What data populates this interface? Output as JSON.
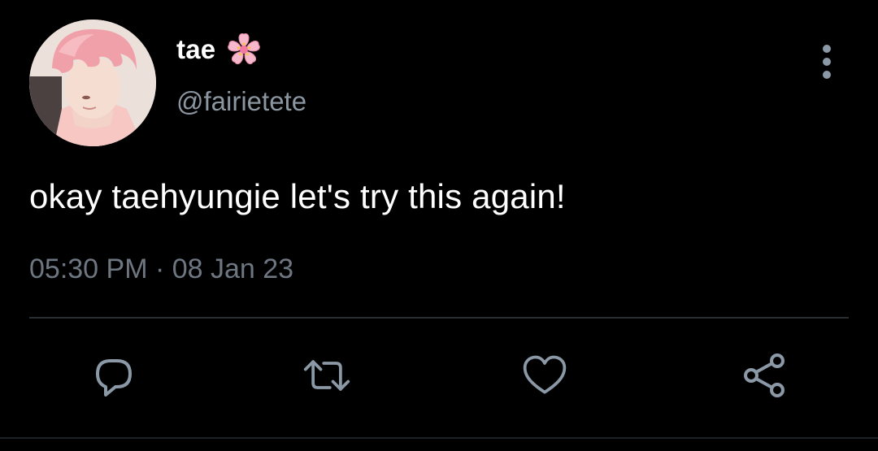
{
  "user": {
    "display_name": "tae",
    "handle": "@fairietete",
    "name_emoji": "cherry-blossom-icon"
  },
  "tweet": {
    "text": "okay taehyungie let's try this again!",
    "timestamp": "05:30 PM · 08 Jan 23"
  },
  "actions": [
    {
      "name": "reply",
      "icon": "reply-icon"
    },
    {
      "name": "retweet",
      "icon": "retweet-icon"
    },
    {
      "name": "like",
      "icon": "heart-icon"
    },
    {
      "name": "share",
      "icon": "share-icon"
    }
  ],
  "colors": {
    "background": "#000000",
    "primary_text": "#ffffff",
    "secondary_text": "#8b96a1",
    "icon": "#8b98a5",
    "divider": "#2a2f33",
    "avatar_hair": "#f0a0a8"
  }
}
